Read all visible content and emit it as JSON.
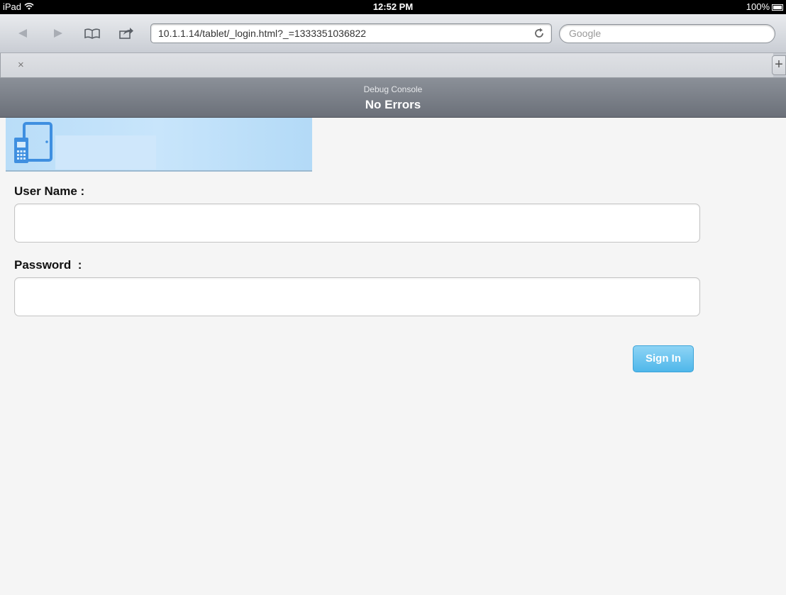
{
  "status_bar": {
    "device": "iPad",
    "time": "12:52 PM",
    "battery": "100%"
  },
  "browser": {
    "url": "10.1.1.14/tablet/_login.html?_=1333351036822",
    "search_placeholder": "Google",
    "tab_close": "×",
    "new_tab": "+"
  },
  "debug_console": {
    "title": "Debug Console",
    "status": "No Errors"
  },
  "form": {
    "username_label": "User Name :",
    "username_value": "",
    "password_label": "Password  :",
    "password_value": "",
    "signin_label": "Sign In"
  },
  "colors": {
    "accent": "#4fb7ea",
    "banner": "#b9ddf8",
    "logo": "#3f8fe0"
  }
}
